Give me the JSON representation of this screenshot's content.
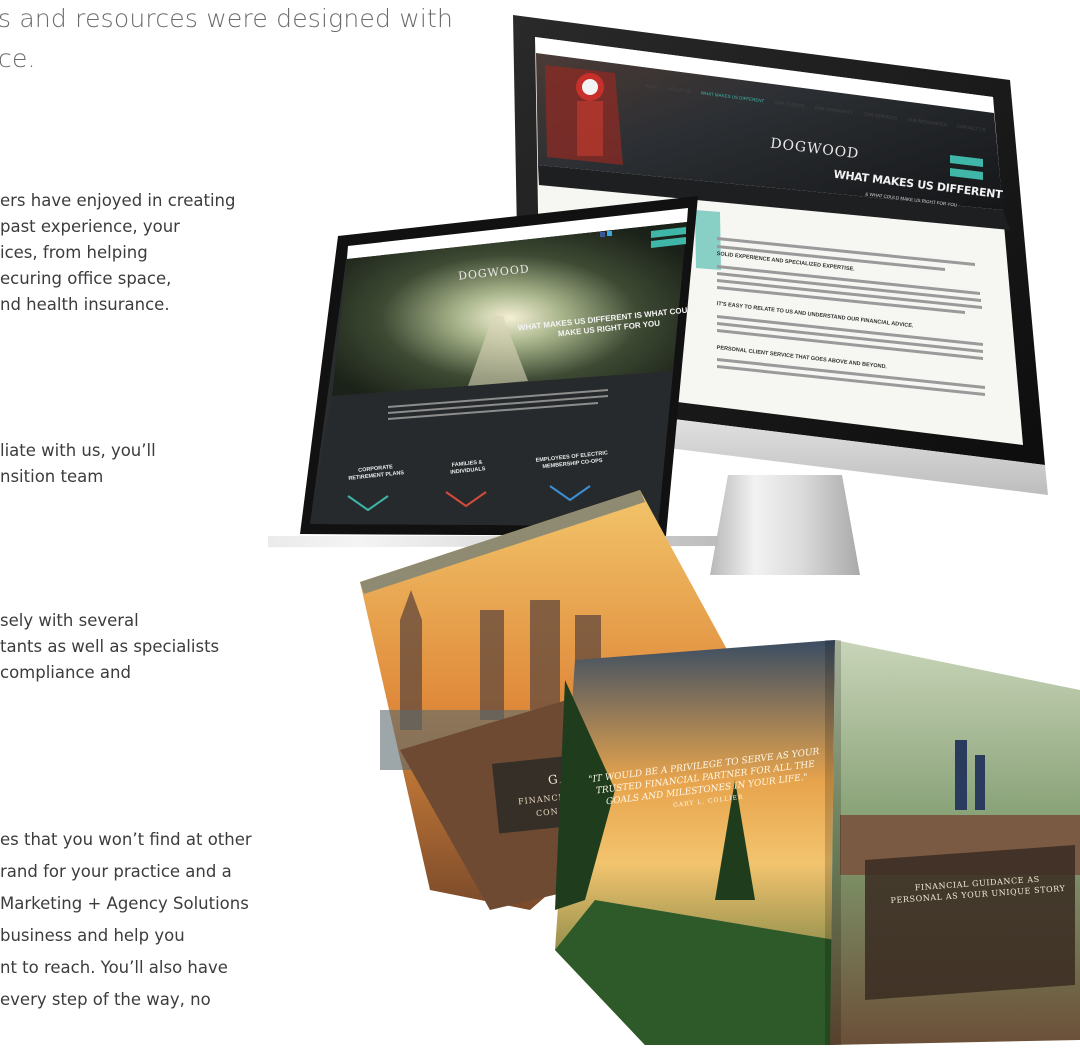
{
  "copy": {
    "lead_lines": [
      "s and resources were designed with",
      "ce."
    ],
    "para1": [
      "ers have enjoyed in creating",
      "past experience, your",
      "ices, from helping",
      "ecuring office space,",
      "nd health insurance."
    ],
    "para2": [
      "liate with us, you’ll",
      "nsition team"
    ],
    "para3": [
      "sely with several",
      "tants as well as specialists",
      "compliance and"
    ],
    "para4": [
      "es that you won’t find at other",
      "rand for your practice and a",
      "Marketing + Agency Solutions",
      "business and help you",
      "nt to reach. You’ll also have",
      "every step of the way, no"
    ]
  },
  "imac_site": {
    "nav": [
      "HOME",
      "ABOUT US",
      "WHAT MAKES US DIFFERENT",
      "OUR CLIENTS",
      "OUR COMMUNITY",
      "OUR SERVICES",
      "OUR RESOURCES",
      "CONTACT US"
    ],
    "logo": "DOGWOOD",
    "hero_heading": "WHAT MAKES US DIFFERENT",
    "hero_sub": "& WHAT COULD MAKE US RIGHT FOR YOU",
    "sections": [
      "SOLID EXPERIENCE AND SPECIALIZED EXPERTISE.",
      "IT'S EASY TO RELATE TO US AND UNDERSTAND OUR FINANCIAL ADVICE.",
      "PERSONAL CLIENT SERVICE THAT GOES ABOVE AND BEYOND."
    ]
  },
  "laptop_site": {
    "logo": "DOGWOOD",
    "hero_heading_1": "WHAT MAKES US DIFFERENT IS WHAT COULD",
    "hero_heading_2": "MAKE US RIGHT FOR YOU",
    "tiles": [
      {
        "l1": "CORPORATE",
        "l2": "RETIREMENT PLANS"
      },
      {
        "l1": "FAMILIES &",
        "l2": "INDIVIDUALS"
      },
      {
        "l1": "EMPLOYEES OF ELECTRIC",
        "l2": "MEMBERSHIP CO-OPS"
      }
    ]
  },
  "brochure_back": {
    "caption": "GA",
    "sub1": "FINANCI",
    "sub2": "CON"
  },
  "brochure_front": {
    "quote_1": "\"IT WOULD BE A PRIVILEGE TO SERVE AS YOUR",
    "quote_2": "TRUSTED FINANCIAL PARTNER FOR ALL THE",
    "quote_3": "GOALS AND MILESTONES IN YOUR LIFE.\"",
    "attribution": "GARY L. COLLIER",
    "panel_1": "FINANCIAL GUIDANCE AS",
    "panel_2": "PERSONAL AS YOUR UNIQUE STORY"
  },
  "colors": {
    "accent_teal": "#3fb6a8",
    "site_dark": "#1f2224",
    "copy_grey": "#6b6b6b"
  }
}
